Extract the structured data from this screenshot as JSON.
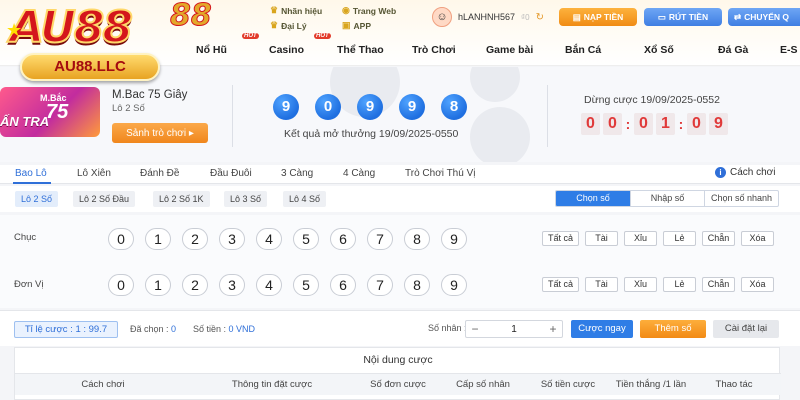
{
  "brand": {
    "logo": "AU88",
    "logo_tail": "88",
    "domain": "AU88.LLC"
  },
  "toplinks": [
    {
      "icon": "crown-icon",
      "label": "Nhãn hiệu"
    },
    {
      "icon": "globe-icon",
      "label": "Trang Web"
    },
    {
      "icon": "crown-icon",
      "label": "Đại Lý"
    },
    {
      "icon": "app-icon",
      "label": "APP"
    }
  ],
  "user": {
    "name": "hLANHNH567",
    "balance": "₫0"
  },
  "header_buttons": {
    "deposit": "NẠP TIỀN",
    "withdraw": "RÚT TIỀN",
    "transfer": "CHUYỂN Q"
  },
  "nav": {
    "items": [
      "Nổ Hũ",
      "Casino",
      "Thể Thao",
      "Trò Chơi",
      "Game bài",
      "Bắn Cá",
      "Xổ Số",
      "Đá Gà",
      "E-S"
    ],
    "hot_badge": "HOT"
  },
  "promo": {
    "line1": "M.Bắc",
    "line2": "75",
    "line3": "ẤN TRA"
  },
  "game": {
    "name": "M.Bac 75 Giây",
    "subtitle": "Lô 2 Số",
    "play_button": "Sảnh trò chơi ▸"
  },
  "result": {
    "balls": [
      "9",
      "0",
      "9",
      "9",
      "8"
    ],
    "label": "Kết quả mở thưởng 19/09/2025-0550"
  },
  "countdown": {
    "label": "Dừng cược 19/09/2025-0552",
    "digits": [
      "0",
      "0",
      "0",
      "1",
      "0",
      "9"
    ],
    "separator": ":"
  },
  "tabs": {
    "items": [
      "Bao Lô",
      "Lô Xiên",
      "Đánh Đề",
      "Đầu Đuôi",
      "3 Càng",
      "4 Càng",
      "Trò Chơi Thú Vị"
    ],
    "active": 0,
    "help": "Cách chơi"
  },
  "subtabs": {
    "items": [
      "Lô 2 Số",
      "Lô 2 Số Đầu",
      "Lô 2 Số 1K",
      "Lô 3 Số",
      "Lô 4 Số"
    ],
    "active": 0
  },
  "modes": {
    "items": [
      "Chọn số",
      "Nhập số",
      "Chọn số nhanh"
    ],
    "active": 0
  },
  "rows": [
    {
      "label": "Chục",
      "numbers": [
        "0",
        "1",
        "2",
        "3",
        "4",
        "5",
        "6",
        "7",
        "8",
        "9"
      ]
    },
    {
      "label": "Đơn Vị",
      "numbers": [
        "0",
        "1",
        "2",
        "3",
        "4",
        "5",
        "6",
        "7",
        "8",
        "9"
      ]
    }
  ],
  "quick_picks": [
    "Tất cả",
    "Tài",
    "Xỉu",
    "Lẻ",
    "Chẵn",
    "Xóa"
  ],
  "controls": {
    "odds": "Tỉ lệ cược : 1 : 99.7",
    "selected_label": "Đã chọn :",
    "selected_value": "0",
    "amount_label": "Số tiền :",
    "amount_value": "0 VND",
    "multiplier_label": "Số nhân :",
    "multiplier_value": "1",
    "minus": "−",
    "plus": "+",
    "bet_now": "Cược ngay",
    "add_numbers": "Thêm số",
    "reset": "Cài đặt lại"
  },
  "bet_table": {
    "title": "Nội dung cược",
    "columns": [
      "Cách chơi",
      "Thông tin đặt cược",
      "Số đơn cược",
      "Cấp số nhân",
      "Số tiền cược",
      "Tiền thắng /1 lần",
      "Thao tác"
    ]
  },
  "colors": {
    "primary_blue": "#2f7de6",
    "accent_orange": "#f28a15",
    "timer_red": "#e03a3a",
    "brand_red": "#d4161c"
  }
}
